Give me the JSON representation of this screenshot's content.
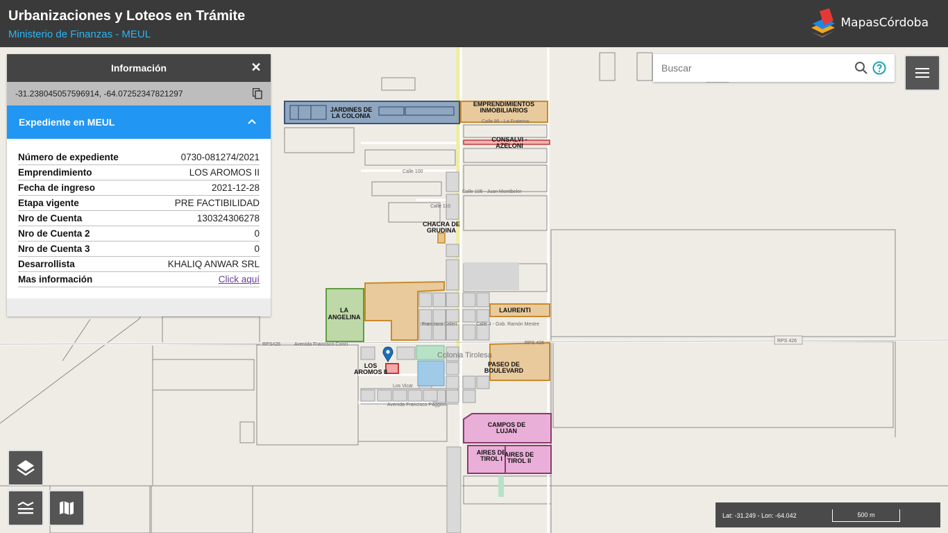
{
  "header": {
    "title": "Urbanizaciones y Loteos en Trámite",
    "subtitle": "Ministerio de Finanzas - MEUL",
    "brand": "MapasCórdoba"
  },
  "info_panel": {
    "title": "Información",
    "close_icon": "close-icon",
    "coordinates": "-31.238045057596914, -64.07252347821297",
    "section_title": "Expediente en MEUL",
    "rows": [
      {
        "label": "Número de expediente",
        "value": "0730-081274/2021"
      },
      {
        "label": "Emprendimiento",
        "value": "LOS AROMOS II"
      },
      {
        "label": "Fecha de ingreso",
        "value": "2021-12-28"
      },
      {
        "label": "Etapa vigente",
        "value": "PRE FACTIBILIDAD"
      },
      {
        "label": "Nro de Cuenta",
        "value": "130324306278"
      },
      {
        "label": "Nro de Cuenta 2",
        "value": "0"
      },
      {
        "label": "Nro de Cuenta 3",
        "value": "0"
      },
      {
        "label": "Desarrollista",
        "value": "KHALIQ ANWAR SRL"
      }
    ],
    "more_label": "Mas información",
    "more_link": "Click aquí"
  },
  "search": {
    "placeholder": "Buscar"
  },
  "map": {
    "places": {
      "jardines": [
        "JARDINES DE",
        "LA COLONIA"
      ],
      "emprendimientos": [
        "EMPRENDIMIENTOS",
        "INMOBILIARIOS"
      ],
      "consalvi": [
        "CONSALVI -",
        "AZELONI"
      ],
      "chacra": [
        "CHACRA DE",
        "GRUDINA"
      ],
      "angelina": [
        "LA",
        "ANGELINA"
      ],
      "laurenti": "LAURENTI",
      "aromos": [
        "LOS",
        "AROMOS II"
      ],
      "paseo": [
        "PASEO DE",
        "BOULEVARD"
      ],
      "campos": [
        "CAMPOS DE",
        "LUJAN"
      ],
      "aires1": [
        "AIRES DE",
        "TIROL I"
      ],
      "aires2": [
        "AIRES DE",
        "TIROL II"
      ],
      "town": "Colonia Tirolesa"
    },
    "streets": {
      "calle100": "Calle 100",
      "calle105": "Calle 105 - Juan Montibeler",
      "calle110": "Calle 110",
      "avenida_conci": "Avenida Francisco Conci",
      "rps426_w": "RPS426",
      "rps426_c": "RPS 426",
      "rps426_e": "RPS 426",
      "francisco_seleri": "Francisco Seleri",
      "gob_mestre": "Calle 4 - Gob. Ramón Mestre",
      "los_vicar": "Los Vicar",
      "avenida_paggion": "Avenida Francisco Paggion",
      "calle95": "Calle 95 - La Fraterna"
    }
  },
  "colors": {
    "header_bg": "#3a3a3a",
    "subtitle": "#29b6f6",
    "accent": "#2196f3",
    "orange_fill": "#e8c48f",
    "orange_stroke": "#c98a2a",
    "blue_fill": "#5b7fa6",
    "blue_stroke": "#37557a",
    "green_fill": "#b5d59c",
    "green_stroke": "#5e9d3e",
    "pink_fill": "#e9a9d6",
    "pink_stroke": "#8a3a6f"
  },
  "scale": {
    "latlon": "Lat: -31.249 - Lon: -64.042",
    "distance": "500 m"
  },
  "controls": {
    "menu_icon": "hamburger-icon",
    "layers_icon": "layers-icon",
    "legend_icon": "legend-icon",
    "basemap_icon": "map-icon"
  }
}
